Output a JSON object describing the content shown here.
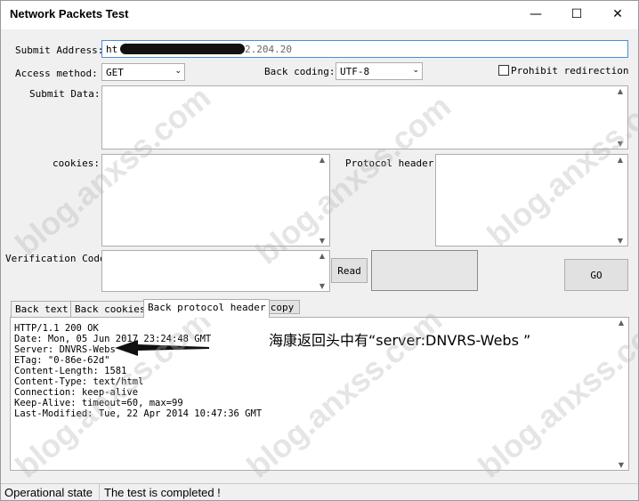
{
  "window": {
    "title": "Network Packets Test",
    "minimize": "—",
    "maximize": "☐",
    "close": "✕"
  },
  "form": {
    "submit_address_label": "Submit Address:",
    "submit_address_value": "ht",
    "submit_address_tail": "2.204.20",
    "access_method_label": "Access method:",
    "access_method_value": "GET",
    "back_coding_label": "Back coding:",
    "back_coding_value": "UTF-8",
    "prohibit_redirection_label": "Prohibit redirection",
    "submit_data_label": "Submit Data:",
    "cookies_label": "cookies:",
    "protocol_header_label": "Protocol header:",
    "verification_code_label": "Verification Code:",
    "read_button": "Read",
    "go_button": "GO"
  },
  "tabs": [
    {
      "label": "Back text"
    },
    {
      "label": "Back cookies"
    },
    {
      "label": "Back protocol header"
    }
  ],
  "copy_button": "copy",
  "output_lines": [
    "HTTP/1.1 200 OK",
    "Date: Mon, 05 Jun 2017 23:24:48 GMT",
    "Server: DNVRS-Webs",
    "ETag: \"0-86e-62d\"",
    "Content-Length: 1581",
    "Content-Type: text/html",
    "Connection: keep-alive",
    "Keep-Alive: timeout=60, max=99",
    "Last-Modified: Tue, 22 Apr 2014 10:47:36 GMT"
  ],
  "annotation": "海康返回头中有“server:DNVRS-Webs ”",
  "status": {
    "label": "Operational state",
    "message": "The test is completed !"
  },
  "watermark": "blog.anxss.com",
  "icons": {
    "scroll_up": "scroll-up-icon",
    "scroll_down": "scroll-down-icon",
    "dropdown": "chevron-down-icon",
    "arrow": "arrow-left-icon"
  }
}
